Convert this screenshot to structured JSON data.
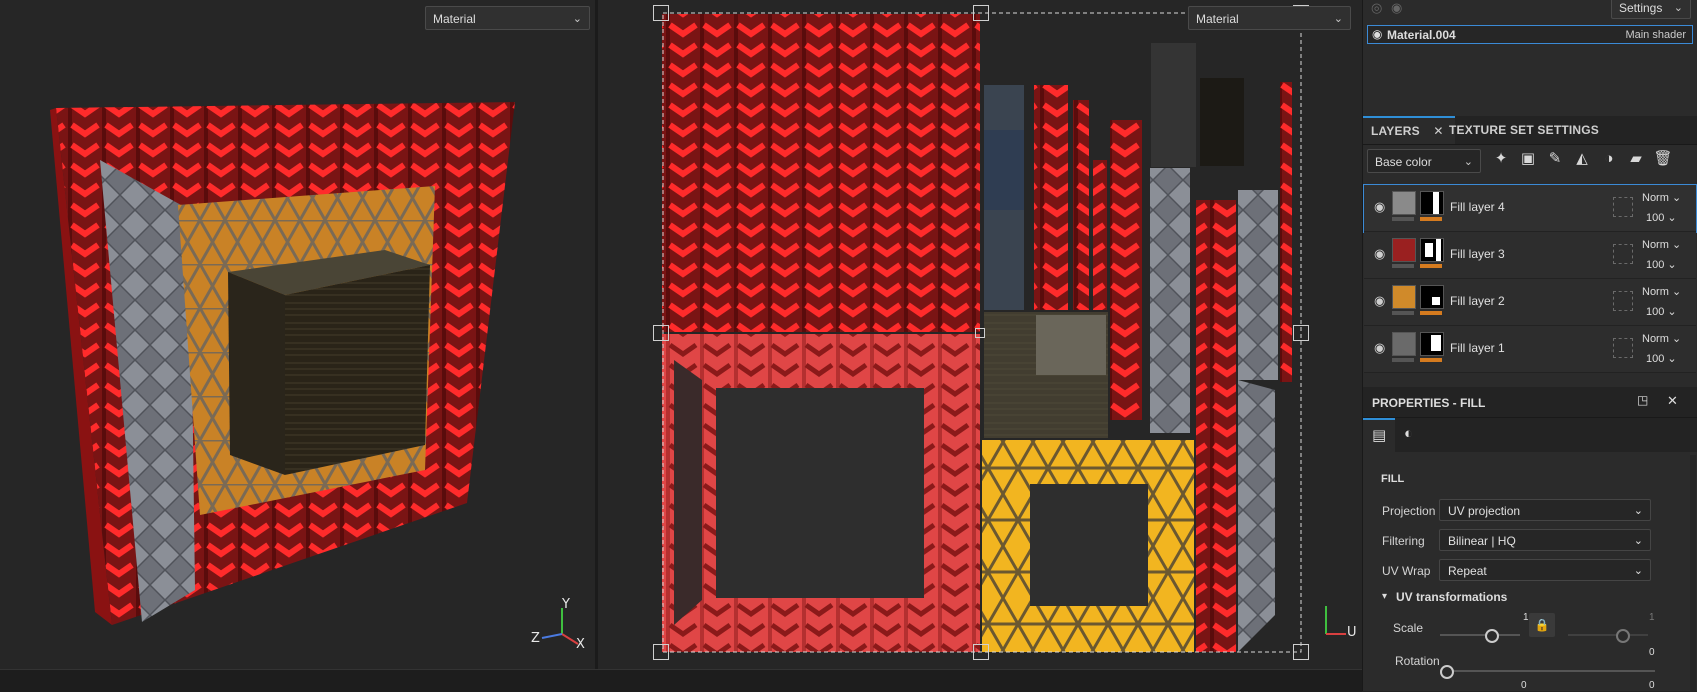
{
  "viewport3d": {
    "mode": "Material"
  },
  "viewport2d": {
    "mode": "Material",
    "axis_u": "U"
  },
  "gizmo3d": {
    "y": "Y",
    "z": "Z",
    "x": "X"
  },
  "shaderPanel": {
    "settings_label": "Settings",
    "material_name": "Material.004",
    "shader_name": "Main shader"
  },
  "layersPanel": {
    "tab_layers": "LAYERS",
    "tab_texture_set": "TEXTURE SET SETTINGS",
    "channel": "Base color",
    "layers": [
      {
        "name": "Fill layer 4",
        "blend": "Norm",
        "opacity": "100",
        "thumb_color": "#8a8a8a"
      },
      {
        "name": "Fill layer 3",
        "blend": "Norm",
        "opacity": "100",
        "thumb_color": "#9a2020"
      },
      {
        "name": "Fill layer 2",
        "blend": "Norm",
        "opacity": "100",
        "thumb_color": "#d08a2a"
      },
      {
        "name": "Fill layer 1",
        "blend": "Norm",
        "opacity": "100",
        "thumb_color": "#6a6a6a"
      }
    ]
  },
  "properties": {
    "title": "PROPERTIES - FILL",
    "section": "FILL",
    "projection_label": "Projection",
    "projection_value": "UV projection",
    "filtering_label": "Filtering",
    "filtering_value": "Bilinear | HQ",
    "uvwrap_label": "UV Wrap",
    "uvwrap_value": "Repeat",
    "uvtransform_title": "UV transformations",
    "scale_label": "Scale",
    "scale_value": "1",
    "scale_value_locked": "1",
    "rotation_label": "Rotation",
    "rotation_value": "0",
    "offset_value_1": "0",
    "offset_value_2": "0",
    "scale_fraction": 0.65
  },
  "colors": {
    "accent": "#2f8fd8",
    "mask_bar": "#d57b1f"
  }
}
